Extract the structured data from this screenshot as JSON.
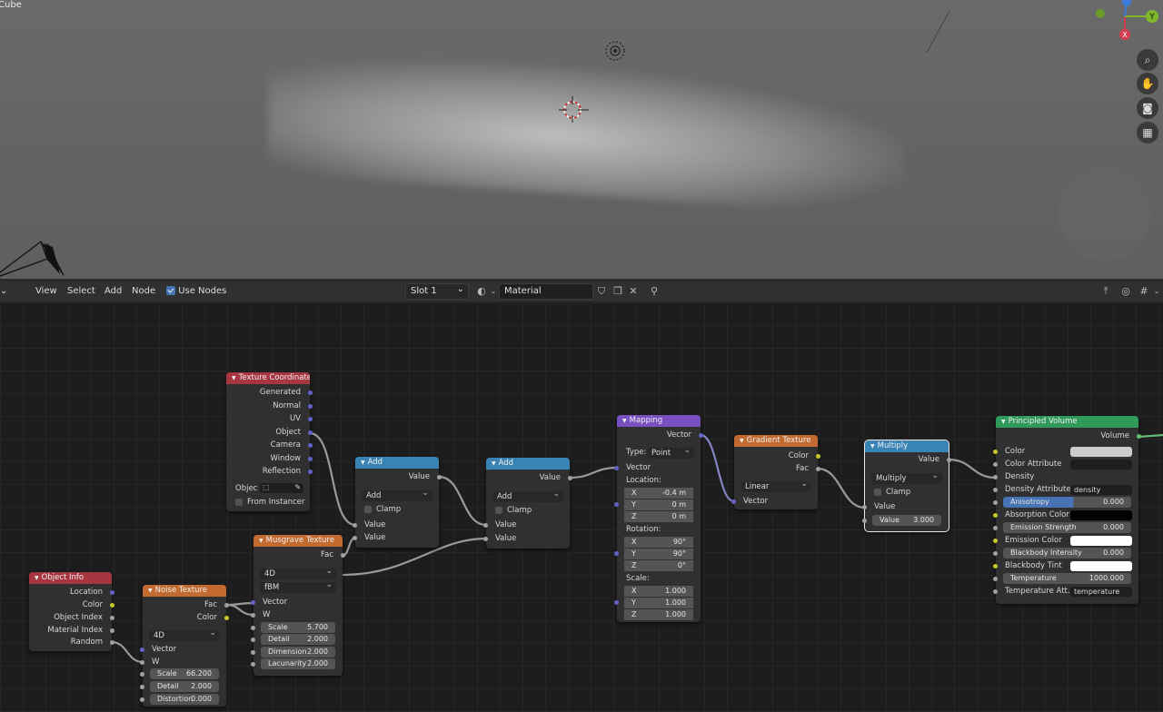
{
  "viewport": {
    "object_label": "Cube",
    "gizmo": {
      "y_label": "Y",
      "x_label": "X"
    }
  },
  "header": {
    "menu": [
      "View",
      "Select",
      "Add",
      "Node"
    ],
    "use_nodes_label": "Use Nodes",
    "slot": "Slot 1",
    "material_name": "Material"
  },
  "nodes": {
    "texcoord": {
      "title": "Texture Coordinate",
      "outputs": [
        "Generated",
        "Normal",
        "UV",
        "Object",
        "Camera",
        "Window",
        "Reflection"
      ],
      "object_label": "Objec",
      "from_instancer": "From Instancer",
      "color": "#a83640"
    },
    "objinfo": {
      "title": "Object Info",
      "outputs": [
        "Location",
        "Color",
        "Object Index",
        "Material Index",
        "Random"
      ],
      "color": "#a83640"
    },
    "noise": {
      "title": "Noise Texture",
      "outputs": [
        "Fac",
        "Color"
      ],
      "dim": "4D",
      "inputs": [
        "Vector",
        "W"
      ],
      "fields": [
        {
          "k": "Scale",
          "v": "66.200"
        },
        {
          "k": "Detail",
          "v": "2.000"
        },
        {
          "k": "Distortion",
          "v": "0.000"
        }
      ],
      "color": "#c26a30"
    },
    "musgrave": {
      "title": "Musgrave Texture",
      "output": "Fac",
      "dim": "4D",
      "type": "fBM",
      "inputs": [
        "Vector",
        "W"
      ],
      "fields": [
        {
          "k": "Scale",
          "v": "5.700"
        },
        {
          "k": "Detail",
          "v": "2.000"
        },
        {
          "k": "Dimension",
          "v": "2.000"
        },
        {
          "k": "Lacunarity",
          "v": "2.000"
        }
      ],
      "color": "#c26a30"
    },
    "add1": {
      "title": "Add",
      "output": "Value",
      "op": "Add",
      "clamp": "Clamp",
      "inputs": [
        "Value",
        "Value"
      ],
      "color": "#3a83b5"
    },
    "add2": {
      "title": "Add",
      "output": "Value",
      "op": "Add",
      "clamp": "Clamp",
      "inputs": [
        "Value",
        "Value"
      ],
      "color": "#3a83b5"
    },
    "mapping": {
      "title": "Mapping",
      "output": "Vector",
      "type_label": "Type:",
      "type_value": "Point",
      "vector_label": "Vector",
      "location_label": "Location:",
      "location": [
        {
          "k": "X",
          "v": "-0.4 m"
        },
        {
          "k": "Y",
          "v": "0 m"
        },
        {
          "k": "Z",
          "v": "0 m"
        }
      ],
      "rotation_label": "Rotation:",
      "rotation": [
        {
          "k": "X",
          "v": "90°"
        },
        {
          "k": "Y",
          "v": "90°"
        },
        {
          "k": "Z",
          "v": "0°"
        }
      ],
      "scale_label": "Scale:",
      "scale": [
        {
          "k": "X",
          "v": "1.000"
        },
        {
          "k": "Y",
          "v": "1.000"
        },
        {
          "k": "Z",
          "v": "1.000"
        }
      ],
      "color": "#7a4fc2"
    },
    "gradient": {
      "title": "Gradient Texture",
      "outputs": [
        "Color",
        "Fac"
      ],
      "type": "Linear",
      "input": "Vector",
      "color": "#c26a30"
    },
    "multiply": {
      "title": "Multiply",
      "output": "Value",
      "op": "Multiply",
      "clamp": "Clamp",
      "input": "Value",
      "field": {
        "k": "Value",
        "v": "3.000"
      },
      "color": "#3a83b5"
    },
    "volume": {
      "title": "Principled Volume",
      "output": "Volume",
      "color": "#2f9a5a",
      "rows": {
        "color": "Color",
        "color_attr": "Color Attribute",
        "density": "Density",
        "density_attr": "Density Attribute",
        "density_attr_value": "density",
        "anisotropy": "Anisotropy",
        "anisotropy_value": "0.000",
        "absorption": "Absorption Color",
        "emission_strength": "Emission Strength",
        "emission_strength_value": "0.000",
        "emission_color": "Emission Color",
        "blackbody_intensity": "Blackbody Intensity",
        "blackbody_intensity_value": "0.000",
        "blackbody_tint": "Blackbody Tint",
        "temperature": "Temperature",
        "temperature_value": "1000.000",
        "temp_attr": "Temperature Att...",
        "temp_attr_value": "temperature"
      }
    }
  }
}
